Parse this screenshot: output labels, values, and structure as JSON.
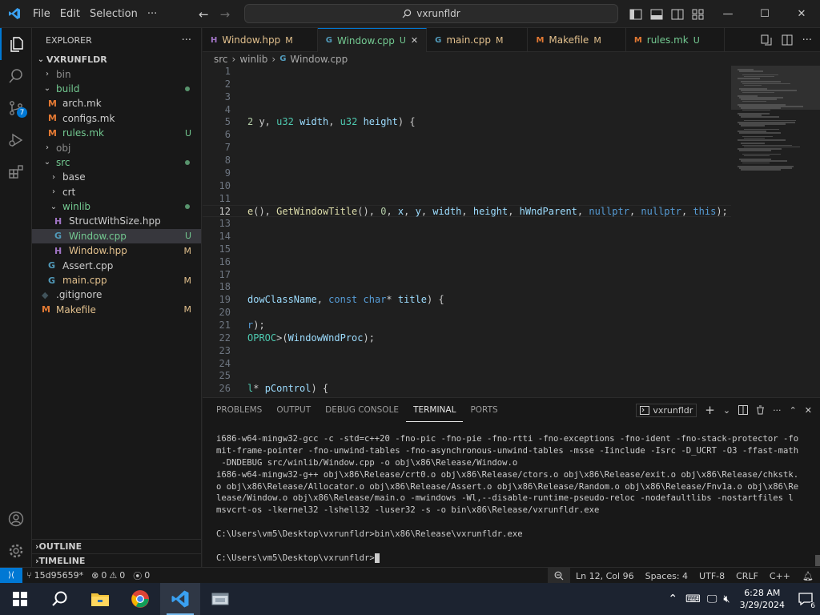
{
  "titlebar": {
    "menu": [
      "File",
      "Edit",
      "Selection",
      "···"
    ],
    "search_text": "vxrunfldr",
    "minimize": "—",
    "maximize": "☐",
    "close": "✕"
  },
  "activity": {
    "source_control_badge": "7"
  },
  "explorer": {
    "header": "EXPLORER",
    "more": "···",
    "root": "VXRUNFLDR",
    "items": [
      {
        "label": "bin",
        "type": "folder",
        "open": false,
        "depth": 1,
        "status": "",
        "color": "dim"
      },
      {
        "label": "build",
        "type": "folder",
        "open": true,
        "depth": 1,
        "status": "dot",
        "color": "unt"
      },
      {
        "label": "arch.mk",
        "type": "mk",
        "depth": 2,
        "status": "",
        "color": "normal"
      },
      {
        "label": "configs.mk",
        "type": "mk",
        "depth": 2,
        "status": "",
        "color": "normal"
      },
      {
        "label": "rules.mk",
        "type": "mk",
        "depth": 2,
        "status": "U",
        "color": "unt"
      },
      {
        "label": "obj",
        "type": "folder",
        "open": false,
        "depth": 1,
        "status": "",
        "color": "dim"
      },
      {
        "label": "src",
        "type": "folder",
        "open": true,
        "depth": 1,
        "status": "dot",
        "color": "unt"
      },
      {
        "label": "base",
        "type": "folder",
        "open": false,
        "depth": 2,
        "status": "",
        "color": "normal"
      },
      {
        "label": "crt",
        "type": "folder",
        "open": false,
        "depth": 2,
        "status": "",
        "color": "normal"
      },
      {
        "label": "winlib",
        "type": "folder",
        "open": true,
        "depth": 2,
        "status": "dot",
        "color": "unt"
      },
      {
        "label": "StructWithSize.hpp",
        "type": "hpp",
        "depth": 3,
        "status": "",
        "color": "normal"
      },
      {
        "label": "Window.cpp",
        "type": "cpp",
        "depth": 3,
        "status": "U",
        "color": "unt",
        "selected": true
      },
      {
        "label": "Window.hpp",
        "type": "hpp",
        "depth": 3,
        "status": "M",
        "color": "mod"
      },
      {
        "label": "Assert.cpp",
        "type": "cpp",
        "depth": 2,
        "status": "",
        "color": "normal"
      },
      {
        "label": "main.cpp",
        "type": "cpp",
        "depth": 2,
        "status": "M",
        "color": "mod"
      },
      {
        "label": ".gitignore",
        "type": "git",
        "depth": 1,
        "status": "",
        "color": "normal"
      },
      {
        "label": "Makefile",
        "type": "make",
        "depth": 1,
        "status": "M",
        "color": "mod"
      }
    ],
    "outline": "OUTLINE",
    "timeline": "TIMELINE"
  },
  "tabs": [
    {
      "label": "Window.hpp",
      "status": "M",
      "icon": "hpp",
      "active": false,
      "color": "mod"
    },
    {
      "label": "Window.cpp",
      "status": "U",
      "icon": "cpp",
      "active": true,
      "color": "unt"
    },
    {
      "label": "main.cpp",
      "status": "M",
      "icon": "cpp",
      "active": false,
      "color": "mod"
    },
    {
      "label": "Makefile",
      "status": "M",
      "icon": "make",
      "active": false,
      "color": "mod"
    },
    {
      "label": "rules.mk",
      "status": "U",
      "icon": "mk",
      "active": false,
      "color": "unt"
    }
  ],
  "breadcrumb": [
    "src",
    "winlib",
    "Window.cpp"
  ],
  "editor": {
    "current_line": 12,
    "lines": [
      {
        "n": 1,
        "html": ""
      },
      {
        "n": 2,
        "html": ""
      },
      {
        "n": 3,
        "html": ""
      },
      {
        "n": 4,
        "html": ""
      },
      {
        "n": 5,
        "html": "<span class=\"nm\">2</span> y, <span class=\"ty\">u32</span> <span class=\"vr\">width</span>, <span class=\"ty\">u32</span> <span class=\"vr\">height</span>) {"
      },
      {
        "n": 6,
        "html": ""
      },
      {
        "n": 7,
        "html": ""
      },
      {
        "n": 8,
        "html": ""
      },
      {
        "n": 9,
        "html": ""
      },
      {
        "n": 10,
        "html": ""
      },
      {
        "n": 11,
        "html": ""
      },
      {
        "n": 12,
        "html": "<span class=\"fn\">e</span>(), <span class=\"fn\">GetWindowTitle</span>(), <span class=\"nm\">0</span>, <span class=\"vr\">x</span>, <span class=\"vr\">y</span>, <span class=\"vr\">width</span>, <span class=\"vr\">height</span>, <span class=\"vr\">hWndParent</span>, <span class=\"kw\">nullptr</span>, <span class=\"kw\">nullptr</span>, <span class=\"kw\">this</span>);"
      },
      {
        "n": 13,
        "html": ""
      },
      {
        "n": 14,
        "html": ""
      },
      {
        "n": 15,
        "html": ""
      },
      {
        "n": 16,
        "html": ""
      },
      {
        "n": 17,
        "html": ""
      },
      {
        "n": 18,
        "html": ""
      },
      {
        "n": 19,
        "html": "<span class=\"vr\">dowClassName</span>, <span class=\"kw\">const</span> <span class=\"kw\">char</span>* <span class=\"vr\">title</span>) {"
      },
      {
        "n": 20,
        "html": ""
      },
      {
        "n": 21,
        "html": "<span class=\"kw\">r</span>);"
      },
      {
        "n": 22,
        "html": "<span class=\"ty\">OPROC</span>&gt;(<span class=\"vr\">WindowWndProc</span>);"
      },
      {
        "n": 23,
        "html": ""
      },
      {
        "n": 24,
        "html": ""
      },
      {
        "n": 25,
        "html": ""
      },
      {
        "n": 26,
        "html": "<span class=\"ty\">l</span>* <span class=\"vr\">pControl</span>) {"
      }
    ]
  },
  "panel": {
    "tabs": [
      "PROBLEMS",
      "OUTPUT",
      "DEBUG CONSOLE",
      "TERMINAL",
      "PORTS"
    ],
    "active_tab": "TERMINAL",
    "terminal_name": "vxrunfldr",
    "terminal_lines": [
      "i686-w64-mingw32-gcc -c -std=c++20 -fno-pic -fno-pie -fno-rtti -fno-exceptions -fno-ident -fno-stack-protector -fo",
      "mit-frame-pointer -fno-unwind-tables -fno-asynchronous-unwind-tables -msse -Iinclude -Isrc -D_UCRT -O3 -ffast-math",
      " -DNDEBUG src/winlib/Window.cpp -o obj\\x86\\Release/Window.o",
      "i686-w64-mingw32-g++ obj\\x86\\Release/crt0.o obj\\x86\\Release/ctors.o obj\\x86\\Release/exit.o obj\\x86\\Release/chkstk.",
      "o obj\\x86\\Release/Allocator.o obj\\x86\\Release/Assert.o obj\\x86\\Release/Random.o obj\\x86\\Release/Fnv1a.o obj\\x86\\Re",
      "lease/Window.o obj\\x86\\Release/main.o -mwindows -Wl,--disable-runtime-pseudo-reloc -nodefaultlibs -nostartfiles l",
      "msvcrt-os -lkernel32 -lshell32 -luser32 -s -o bin\\x86\\Release/vxrunfldr.exe",
      "",
      "C:\\Users\\vm5\\Desktop\\vxrunfldr>bin\\x86\\Release\\vxrunfldr.exe",
      "",
      "C:\\Users\\vm5\\Desktop\\vxrunfldr>"
    ]
  },
  "statusbar": {
    "branch": "15d95659*",
    "errors": "0",
    "warnings": "0",
    "ports": "0",
    "position": "Ln 12, Col 96",
    "spaces": "Spaces: 4",
    "encoding": "UTF-8",
    "eol": "CRLF",
    "language": "C++"
  },
  "taskbar": {
    "time": "6:28 AM",
    "date": "3/29/2024",
    "notifications": "6"
  },
  "colors": {
    "accent": "#0078d4",
    "modified": "#e2c08d",
    "untracked": "#73c991"
  }
}
